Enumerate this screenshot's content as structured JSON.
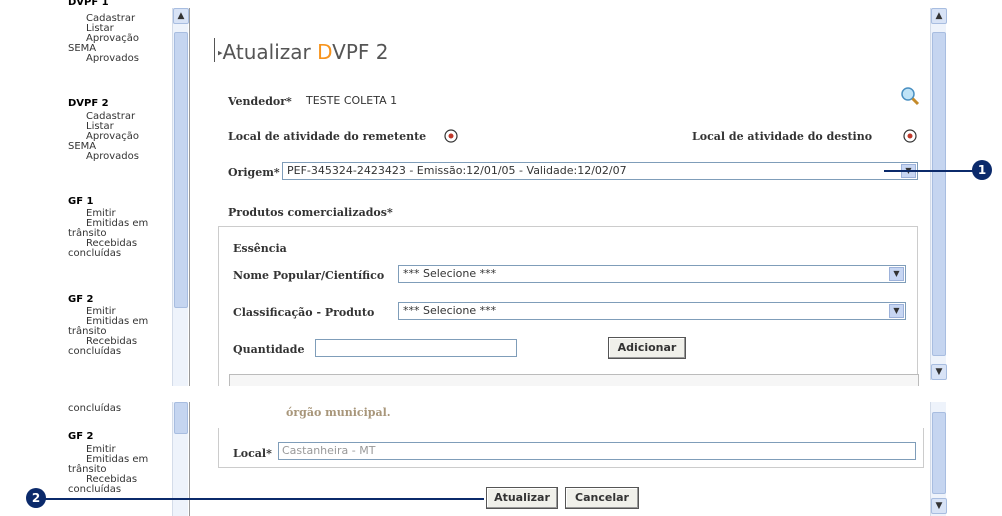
{
  "sidebar_top": {
    "groups": [
      {
        "title": "DVPF 1",
        "items": [
          "Cadastrar",
          "Listar",
          "Aprovação"
        ],
        "sema": "SEMA",
        "sema_item": "Aprovados"
      },
      {
        "title": "DVPF 2",
        "items": [
          "Cadastrar",
          "Listar",
          "Aprovação"
        ],
        "sema": "SEMA",
        "sema_item": "Aprovados"
      },
      {
        "title": "GF 1",
        "items": [
          "Emitir",
          "Emitidas em"
        ],
        "transit": "trânsito",
        "received": "Recebidas",
        "concluded": "concluídas"
      },
      {
        "title": "GF 2",
        "items": [
          "Emitir",
          "Emitidas em"
        ],
        "transit": "trânsito",
        "received": "Recebidas",
        "concluded": "concluídas"
      }
    ]
  },
  "sidebar_bottom": {
    "concluded_top": "concluídas",
    "title": "GF 2",
    "items": [
      "Emitir",
      "Emitidas em"
    ],
    "transit": "trânsito",
    "received": "Recebidas",
    "concluded": "concluídas"
  },
  "form": {
    "title_prefix": "Atualizar ",
    "title_accent": "D",
    "title_rest": "VPF 2",
    "accent_color": "#f7941d",
    "vendedor_label": "Vendedor*",
    "vendedor_value": "TESTE COLETA 1",
    "local_remetente_label": "Local de atividade do remetente",
    "local_destino_label": "Local de atividade do destino",
    "origem_label": "Origem*",
    "origem_value": "PEF-345324-2423423 - Emissão:12/01/05 - Validade:12/02/07",
    "produtos_label": "Produtos comercializados*",
    "essencia_label": "Essência",
    "nome_label": "Nome Popular/Científico",
    "nome_value": "*** Selecione ***",
    "classificacao_label": "Classificação - Produto",
    "classificacao_value": "*** Selecione ***",
    "quantidade_label": "Quantidade",
    "quantidade_value": "",
    "adicionar_label": "Adicionar"
  },
  "form_bottom": {
    "orgao_text": "órgão municipal.",
    "local_label": "Local*",
    "local_value": "Castanheira - MT",
    "atualizar_label": "Atualizar",
    "cancelar_label": "Cancelar"
  },
  "callouts": {
    "one": "1",
    "two": "2"
  }
}
